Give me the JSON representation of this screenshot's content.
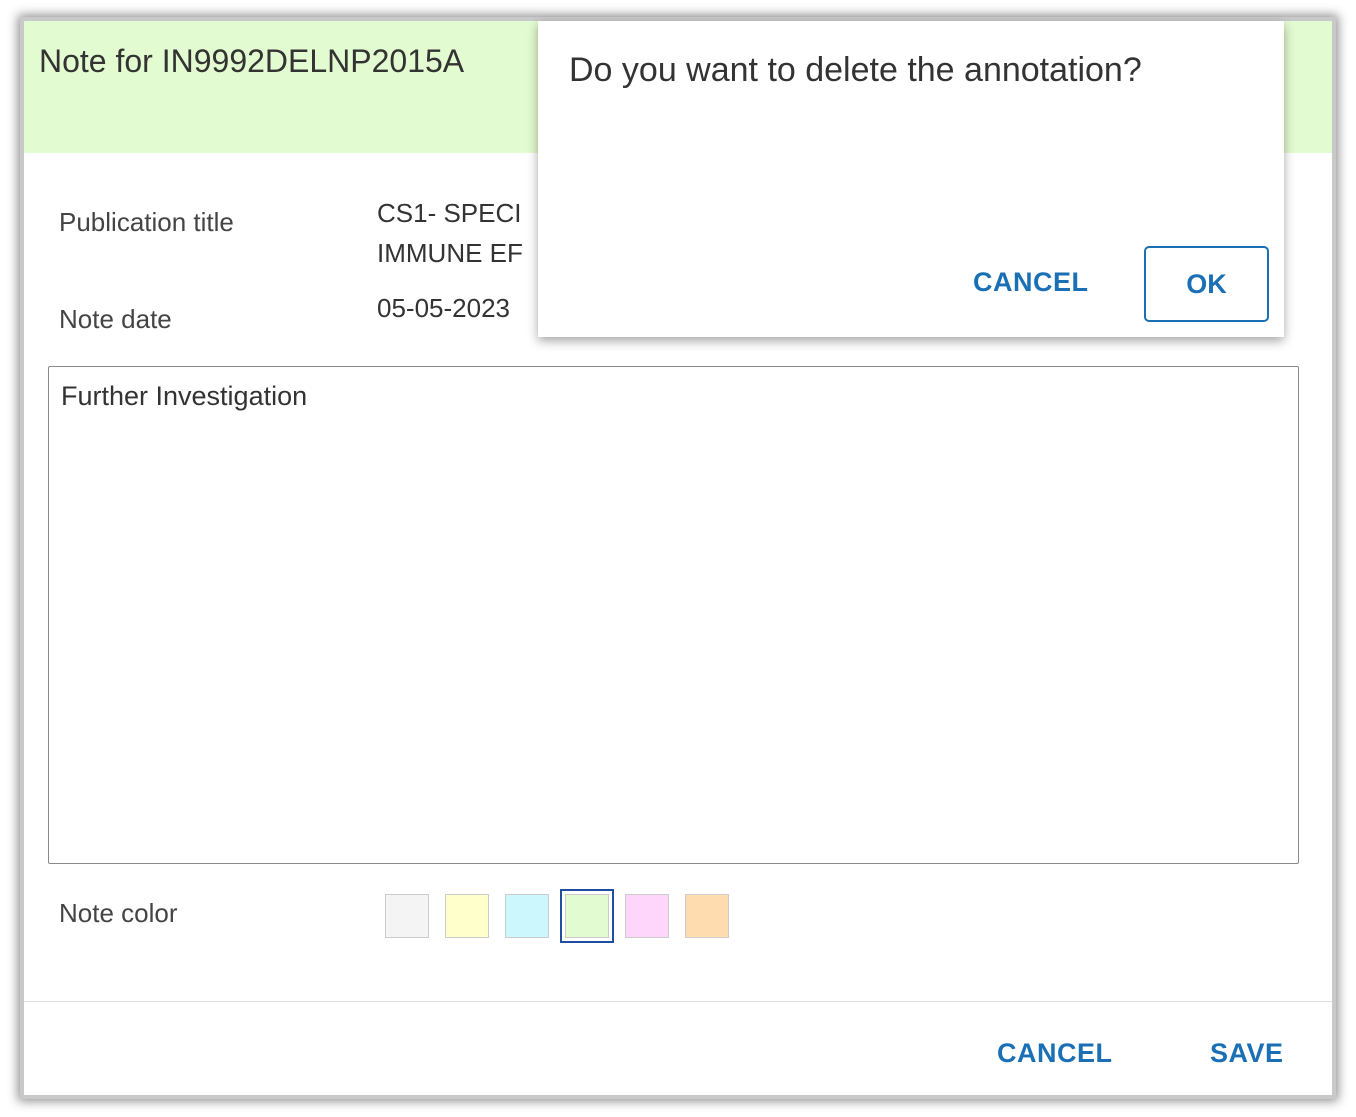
{
  "dialog": {
    "title": "Note for IN9992DELNP2015A",
    "header_color": "#e3fbd0",
    "fields": {
      "publication_title_label": "Publication title",
      "publication_title_line1": "CS1- SPECI",
      "publication_title_line2": "IMMUNE EF",
      "note_date_label": "Note date",
      "note_date_value": "05-05-2023"
    },
    "note_text": "Further Investigation",
    "note_color_label": "Note color",
    "colors": [
      {
        "name": "gray",
        "hex": "#f4f4f4",
        "selected": false
      },
      {
        "name": "yellow",
        "hex": "#ffffcc",
        "selected": false
      },
      {
        "name": "cyan",
        "hex": "#ccf7fd",
        "selected": false
      },
      {
        "name": "green",
        "hex": "#e3fbd0",
        "selected": true
      },
      {
        "name": "pink",
        "hex": "#ffd6fb",
        "selected": false
      },
      {
        "name": "orange",
        "hex": "#ffdcb0",
        "selected": false
      }
    ],
    "footer": {
      "cancel_label": "CANCEL",
      "save_label": "SAVE"
    }
  },
  "confirm": {
    "message": "Do you want to delete the annotation?",
    "cancel_label": "CANCEL",
    "ok_label": "OK"
  },
  "accent_color": "#1a6fb5"
}
